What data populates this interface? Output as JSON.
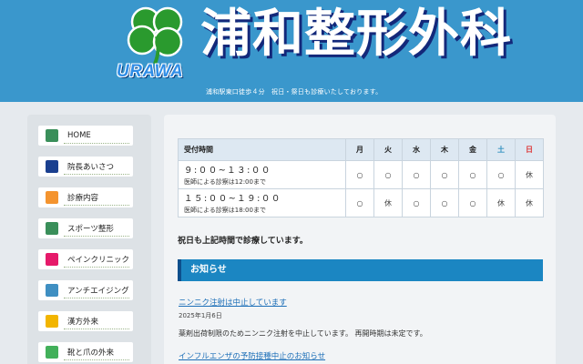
{
  "header": {
    "title": "浦和整形外科",
    "logo_text": "URAWA",
    "subtitle": "浦和駅東口徒歩４分　祝日・祭日も診療いたしております。",
    "logo_icon": "clover-icon",
    "colors": {
      "background": "#3a97cc",
      "title_shadow": "#13287a",
      "clover": "#2a9a2e"
    }
  },
  "sidebar": {
    "items": [
      {
        "label": "HOME",
        "color": "#3a8f5a"
      },
      {
        "label": "院長あいさつ",
        "color": "#1a3f8f"
      },
      {
        "label": "診療内容",
        "color": "#f4942f"
      },
      {
        "label": "スポーツ整形",
        "color": "#3a8f5a"
      },
      {
        "label": "ペインクリニック",
        "color": "#e61a6a"
      },
      {
        "label": "アンチエイジング",
        "color": "#3f8fc2"
      },
      {
        "label": "漢方外来",
        "color": "#f2b500"
      },
      {
        "label": "靴と爪の外来",
        "color": "#42b05a"
      }
    ]
  },
  "hours": {
    "header_label": "受付時間",
    "days": [
      "月",
      "火",
      "水",
      "木",
      "金",
      "土",
      "日"
    ],
    "rows": [
      {
        "time": "９:００~１３:００",
        "note": "医師による診察は12:00まで",
        "cells": [
          "○",
          "○",
          "○",
          "○",
          "○",
          "○",
          "休"
        ]
      },
      {
        "time": "１５:００~１９:００",
        "note": "医師による診察は18:00まで",
        "cells": [
          "○",
          "休",
          "○",
          "○",
          "○",
          "休",
          "休"
        ]
      }
    ],
    "holiday_note": "祝日も上記時間で診療しています。"
  },
  "news": {
    "heading": "お知らせ",
    "items": [
      {
        "title": "ニンニク注射は中止しています",
        "date": "2025年1月6日",
        "body": "薬剤出荷制限のためニンニク注射を中止しています。 再開時期は未定です。"
      },
      {
        "title": "インフルエンザの予防接種中止のお知らせ"
      }
    ]
  }
}
